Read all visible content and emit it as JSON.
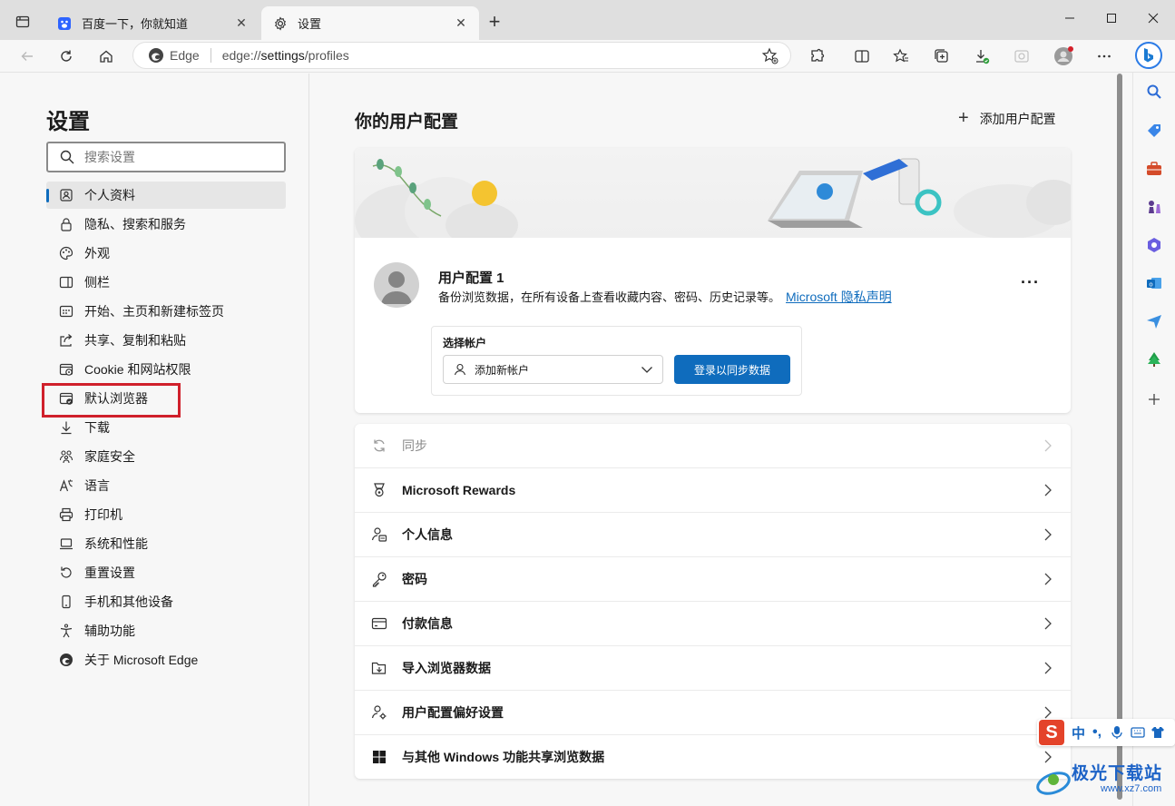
{
  "tabs": [
    {
      "title": "百度一下，你就知道",
      "active": false,
      "icon": "baidu-icon"
    },
    {
      "title": "设置",
      "active": true,
      "icon": "gear-icon"
    }
  ],
  "address": {
    "brand": "Edge",
    "url_prefix": "edge://",
    "url_host": "settings",
    "url_path": "/profiles"
  },
  "leftnav": {
    "title": "设置",
    "search_placeholder": "搜索设置",
    "items": [
      {
        "label": "个人资料",
        "icon": "profile-icon",
        "selected": true
      },
      {
        "label": "隐私、搜索和服务",
        "icon": "lock-icon"
      },
      {
        "label": "外观",
        "icon": "palette-icon"
      },
      {
        "label": "侧栏",
        "icon": "sidebar-icon"
      },
      {
        "label": "开始、主页和新建标签页",
        "icon": "home-grid-icon"
      },
      {
        "label": "共享、复制和粘贴",
        "icon": "share-icon"
      },
      {
        "label": "Cookie 和网站权限",
        "icon": "cookie-icon"
      },
      {
        "label": "默认浏览器",
        "icon": "default-browser-icon"
      },
      {
        "label": "下载",
        "icon": "download-icon"
      },
      {
        "label": "家庭安全",
        "icon": "family-icon"
      },
      {
        "label": "语言",
        "icon": "language-icon"
      },
      {
        "label": "打印机",
        "icon": "printer-icon"
      },
      {
        "label": "系统和性能",
        "icon": "laptop-icon"
      },
      {
        "label": "重置设置",
        "icon": "reset-icon"
      },
      {
        "label": "手机和其他设备",
        "icon": "phone-icon"
      },
      {
        "label": "辅助功能",
        "icon": "accessibility-icon"
      },
      {
        "label": "关于 Microsoft Edge",
        "icon": "edge-icon"
      }
    ]
  },
  "main": {
    "title": "你的用户配置",
    "add_profile": "添加用户配置",
    "profile": {
      "name": "用户配置 1",
      "desc": "备份浏览数据，在所有设备上查看收藏内容、密码、历史记录等。",
      "privacy_link": "Microsoft 隐私声明",
      "more": "···"
    },
    "account": {
      "label": "选择帐户",
      "select_value": "添加新帐户",
      "signin_button": "登录以同步数据"
    },
    "rows": [
      {
        "label": "同步",
        "icon": "sync-icon",
        "disabled": true
      },
      {
        "label": "Microsoft Rewards",
        "icon": "rewards-icon"
      },
      {
        "label": "个人信息",
        "icon": "personal-info-icon"
      },
      {
        "label": "密码",
        "icon": "key-icon"
      },
      {
        "label": "付款信息",
        "icon": "card-icon"
      },
      {
        "label": "导入浏览器数据",
        "icon": "import-icon"
      },
      {
        "label": "用户配置偏好设置",
        "icon": "profile-prefs-icon"
      },
      {
        "label": "与其他 Windows 功能共享浏览数据",
        "icon": "windows-icon"
      }
    ]
  },
  "ime": {
    "logo": "S",
    "mode": "中",
    "punct": "•,"
  },
  "watermark": {
    "text": "极光下载站",
    "url": "www.xz7.com"
  },
  "colors": {
    "accent": "#0f6cbd",
    "highlight": "#d0202b"
  }
}
